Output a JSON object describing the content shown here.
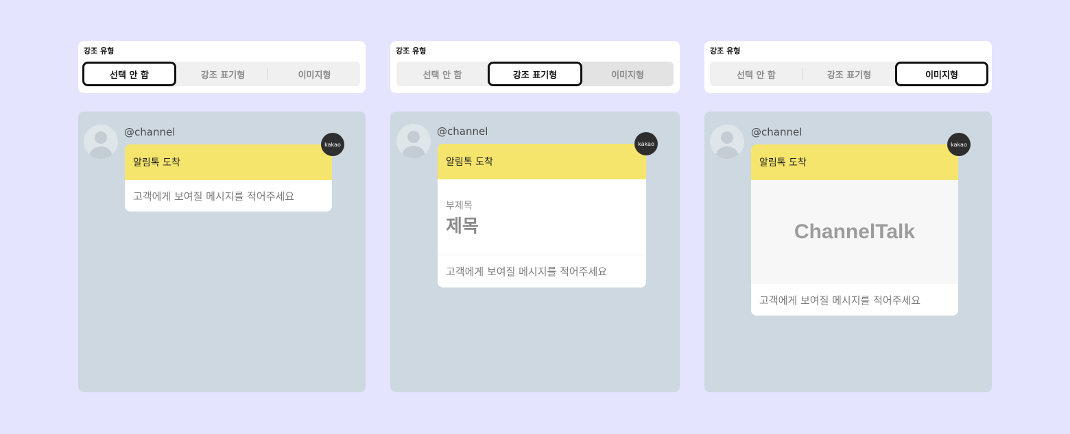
{
  "panels": [
    {
      "selector": {
        "label": "강조 유형",
        "options": [
          "선택 안 함",
          "강조 표기형",
          "이미지형"
        ],
        "selected": "선택 안 함"
      },
      "preview": {
        "channel": "@channel",
        "badge": "kakao",
        "header": "알림톡 도착",
        "message": "고객에게 보여질 메시지를 적어주세요"
      }
    },
    {
      "selector": {
        "label": "강조 유형",
        "options": [
          "선택 안 함",
          "강조 표기형",
          "이미지형"
        ],
        "selected": "강조 표기형"
      },
      "preview": {
        "channel": "@channel",
        "badge": "kakao",
        "header": "알림톡 도착",
        "emphasis_subtitle": "부제목",
        "emphasis_title": "제목",
        "message": "고객에게 보여질 메시지를 적어주세요"
      }
    },
    {
      "selector": {
        "label": "강조 유형",
        "options": [
          "선택 안 함",
          "강조 표기형",
          "이미지형"
        ],
        "selected": "이미지형"
      },
      "preview": {
        "channel": "@channel",
        "badge": "kakao",
        "header": "알림톡 도착",
        "image_text": "ChannelTalk",
        "message": "고객에게 보여질 메시지를 적어주세요"
      }
    }
  ],
  "colors": {
    "background": "#e4e4fe",
    "preview_bg": "#cdd8e0",
    "kakao_yellow": "#f5e56d",
    "badge_dark": "#2e2e2e"
  }
}
